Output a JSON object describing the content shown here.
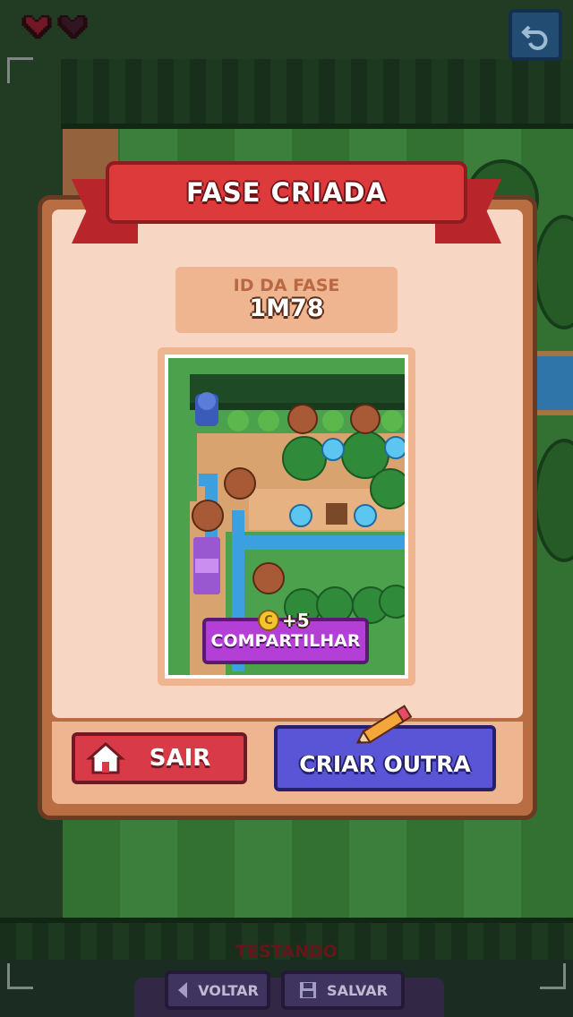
{
  "hud": {
    "hearts": [
      {
        "icon": "heart-icon",
        "state": "full"
      },
      {
        "icon": "heart-icon",
        "state": "empty"
      }
    ],
    "undo_icon": "undo-icon",
    "status_label": "TESTANDO",
    "back_label": "VOLTAR",
    "save_label": "SALVAR"
  },
  "dialog": {
    "title": "FASE CRIADA",
    "level_id_label": "ID DA FASE",
    "level_id_value": "1M78",
    "share_label": "COMPARTILHAR",
    "share_reward": "+5",
    "coin_glyph": "C",
    "exit_label": "SAIR",
    "create_another_label": "CRIAR OUTRA"
  },
  "colors": {
    "ribbon": "#dd3b3b",
    "exit_button": "#d83a47",
    "create_button": "#5a55d6",
    "share_button": "#b33fd6",
    "dialog_body": "#f7d7c3"
  }
}
